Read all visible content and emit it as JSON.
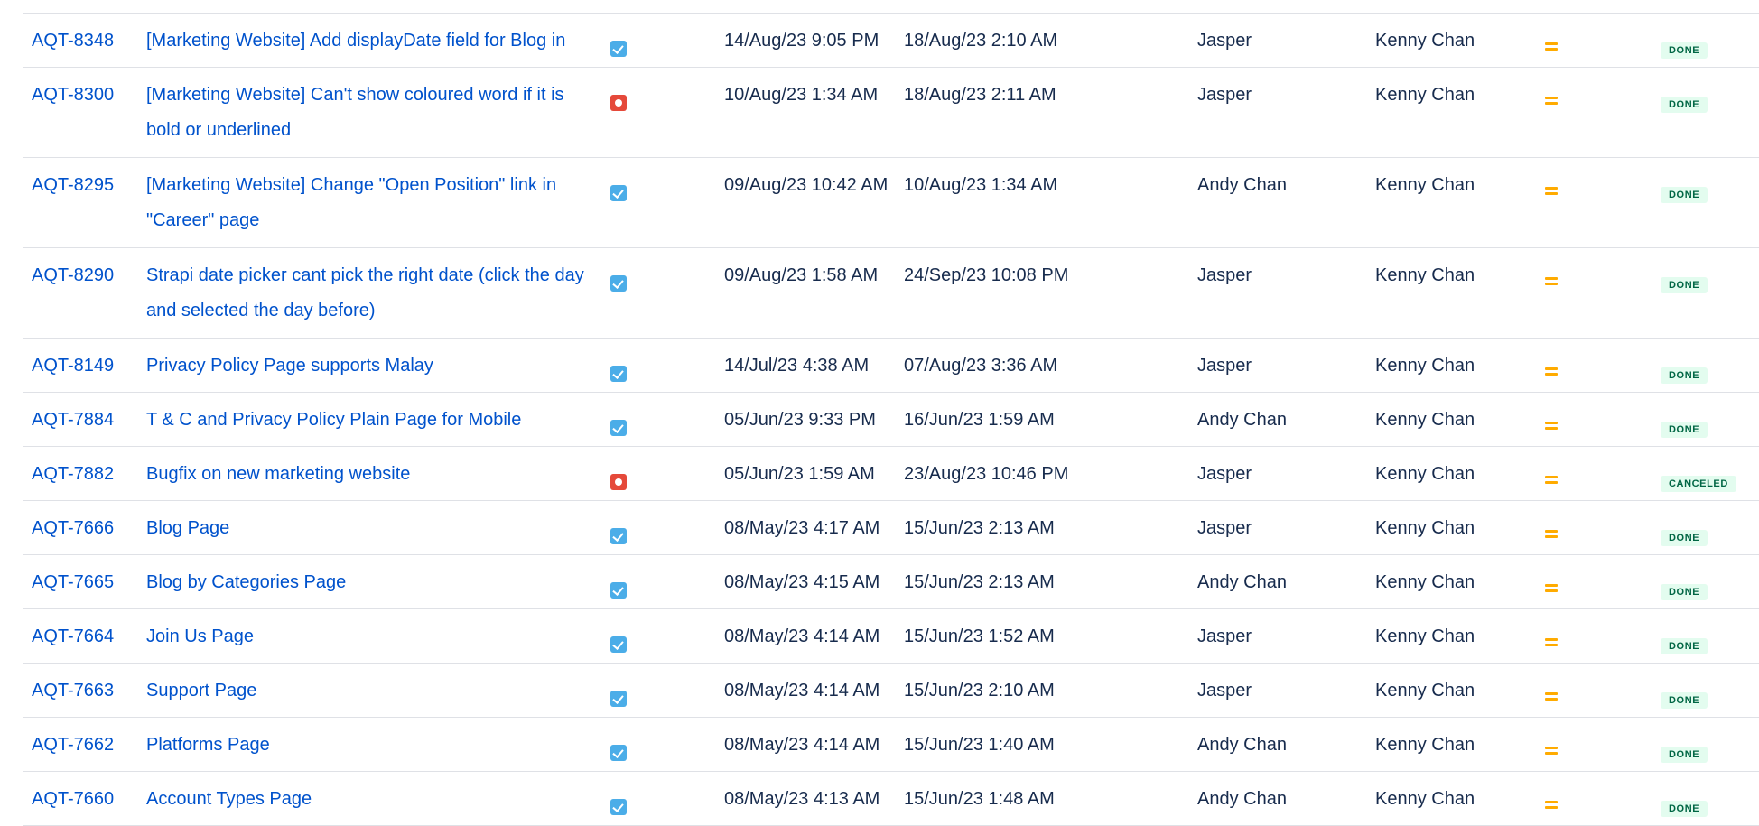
{
  "rows": [
    {
      "key": "AQT-8348",
      "summary": "[Marketing Website] Add displayDate field for Blog in",
      "type": "task",
      "type_icon": "task-icon",
      "created": "14/Aug/23 9:05 PM",
      "updated": "18/Aug/23 2:10 AM",
      "reporter": "Jasper",
      "assignee": "Kenny Chan",
      "priority": "medium",
      "status": "DONE"
    },
    {
      "key": "AQT-8300",
      "summary": "[Marketing Website] Can't show coloured word if it is bold or underlined",
      "type": "bug",
      "type_icon": "bug-icon",
      "created": "10/Aug/23 1:34 AM",
      "updated": "18/Aug/23 2:11 AM",
      "reporter": "Jasper",
      "assignee": "Kenny Chan",
      "priority": "medium",
      "status": "DONE"
    },
    {
      "key": "AQT-8295",
      "summary": "[Marketing Website] Change \"Open Position\" link in \"Career\" page",
      "type": "task",
      "type_icon": "task-icon",
      "created": "09/Aug/23 10:42 AM",
      "updated": "10/Aug/23 1:34 AM",
      "reporter": "Andy Chan",
      "assignee": "Kenny Chan",
      "priority": "medium",
      "status": "DONE"
    },
    {
      "key": "AQT-8290",
      "summary": "Strapi date picker cant pick the right date (click the day and selected the day before)",
      "type": "task",
      "type_icon": "task-icon",
      "created": "09/Aug/23 1:58 AM",
      "updated": "24/Sep/23 10:08 PM",
      "reporter": "Jasper",
      "assignee": "Kenny Chan",
      "priority": "medium",
      "status": "DONE"
    },
    {
      "key": "AQT-8149",
      "summary": "Privacy Policy Page supports Malay",
      "type": "task",
      "type_icon": "task-icon",
      "created": "14/Jul/23 4:38 AM",
      "updated": "07/Aug/23 3:36 AM",
      "reporter": "Jasper",
      "assignee": "Kenny Chan",
      "priority": "medium",
      "status": "DONE"
    },
    {
      "key": "AQT-7884",
      "summary": "T & C and Privacy Policy Plain Page for Mobile",
      "type": "task",
      "type_icon": "task-icon",
      "created": "05/Jun/23 9:33 PM",
      "updated": "16/Jun/23 1:59 AM",
      "reporter": "Andy Chan",
      "assignee": "Kenny Chan",
      "priority": "medium",
      "status": "DONE"
    },
    {
      "key": "AQT-7882",
      "summary": "Bugfix on new marketing website",
      "type": "bug",
      "type_icon": "bug-icon",
      "created": "05/Jun/23 1:59 AM",
      "updated": "23/Aug/23 10:46 PM",
      "reporter": "Jasper",
      "assignee": "Kenny Chan",
      "priority": "medium",
      "status": "CANCELED"
    },
    {
      "key": "AQT-7666",
      "summary": "Blog Page",
      "type": "task",
      "type_icon": "task-icon",
      "created": "08/May/23 4:17 AM",
      "updated": "15/Jun/23 2:13 AM",
      "reporter": "Jasper",
      "assignee": "Kenny Chan",
      "priority": "medium",
      "status": "DONE"
    },
    {
      "key": "AQT-7665",
      "summary": "Blog by Categories Page",
      "type": "task",
      "type_icon": "task-icon",
      "created": "08/May/23 4:15 AM",
      "updated": "15/Jun/23 2:13 AM",
      "reporter": "Andy Chan",
      "assignee": "Kenny Chan",
      "priority": "medium",
      "status": "DONE"
    },
    {
      "key": "AQT-7664",
      "summary": "Join Us Page",
      "type": "task",
      "type_icon": "task-icon",
      "created": "08/May/23 4:14 AM",
      "updated": "15/Jun/23 1:52 AM",
      "reporter": "Jasper",
      "assignee": "Kenny Chan",
      "priority": "medium",
      "status": "DONE"
    },
    {
      "key": "AQT-7663",
      "summary": "Support Page",
      "type": "task",
      "type_icon": "task-icon",
      "created": "08/May/23 4:14 AM",
      "updated": "15/Jun/23 2:10 AM",
      "reporter": "Jasper",
      "assignee": "Kenny Chan",
      "priority": "medium",
      "status": "DONE"
    },
    {
      "key": "AQT-7662",
      "summary": "Platforms Page",
      "type": "task",
      "type_icon": "task-icon",
      "created": "08/May/23 4:14 AM",
      "updated": "15/Jun/23 1:40 AM",
      "reporter": "Andy Chan",
      "assignee": "Kenny Chan",
      "priority": "medium",
      "status": "DONE"
    },
    {
      "key": "AQT-7660",
      "summary": "Account Types Page",
      "type": "task",
      "type_icon": "task-icon",
      "created": "08/May/23 4:13 AM",
      "updated": "15/Jun/23 1:48 AM",
      "reporter": "Andy Chan",
      "assignee": "Kenny Chan",
      "priority": "medium",
      "status": "DONE"
    }
  ],
  "colors": {
    "link": "#0052cc",
    "text": "#172b4d",
    "task_icon": "#4bade8",
    "bug_icon": "#e5493a",
    "priority_medium": "#ffab00",
    "status_done_bg": "#e3fcef",
    "status_done_fg": "#006644",
    "divider": "#dfe1e6"
  }
}
